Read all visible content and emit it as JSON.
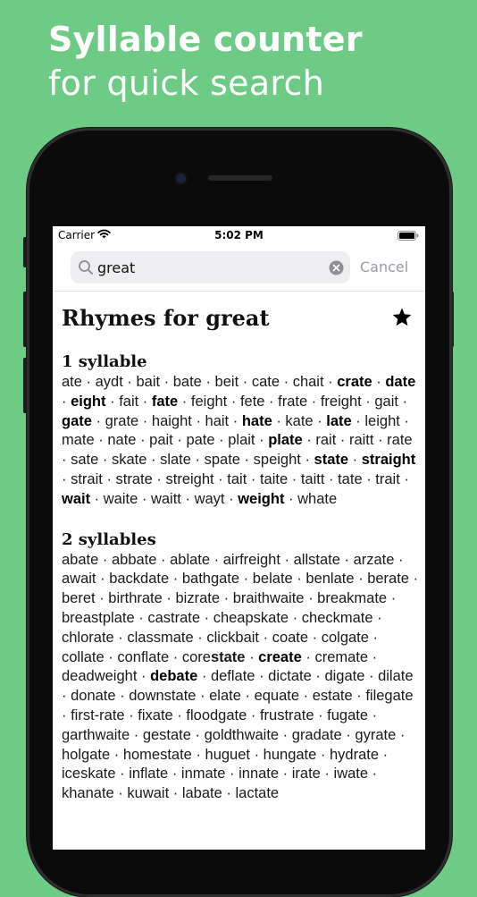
{
  "headline": {
    "bold": "Syllable counter",
    "light": "for quick search"
  },
  "status": {
    "carrier": "Carrier",
    "time": "5:02 PM"
  },
  "search": {
    "value": "great",
    "cancel_label": "Cancel"
  },
  "title": "Rhymes for great",
  "separator": " · ",
  "sections": [
    {
      "heading": "1 syllable",
      "words": [
        {
          "t": "ate"
        },
        {
          "t": "aydt"
        },
        {
          "t": "bait"
        },
        {
          "t": "bate"
        },
        {
          "t": "beit"
        },
        {
          "t": "cate"
        },
        {
          "t": "chait"
        },
        {
          "t": "crate",
          "b": true
        },
        {
          "t": "date",
          "b": true
        },
        {
          "t": "eight",
          "b": true
        },
        {
          "t": "fait"
        },
        {
          "t": "fate",
          "b": true
        },
        {
          "t": "feight"
        },
        {
          "t": "fete"
        },
        {
          "t": "frate"
        },
        {
          "t": "freight"
        },
        {
          "t": "gait"
        },
        {
          "t": "gate",
          "b": true
        },
        {
          "t": "grate"
        },
        {
          "t": "haight"
        },
        {
          "t": "hait"
        },
        {
          "t": "hate",
          "b": true
        },
        {
          "t": "kate"
        },
        {
          "t": "late",
          "b": true
        },
        {
          "t": "leight"
        },
        {
          "t": "mate"
        },
        {
          "t": "nate"
        },
        {
          "t": "pait"
        },
        {
          "t": "pate"
        },
        {
          "t": "plait"
        },
        {
          "t": "plate",
          "b": true
        },
        {
          "t": "rait"
        },
        {
          "t": "raitt"
        },
        {
          "t": "rate"
        },
        {
          "t": "sate"
        },
        {
          "t": "skate"
        },
        {
          "t": "slate"
        },
        {
          "t": "spate"
        },
        {
          "t": "speight"
        },
        {
          "t": "state",
          "b": true
        },
        {
          "t": "straight",
          "b": true
        },
        {
          "t": "strait"
        },
        {
          "t": "strate"
        },
        {
          "t": "streight"
        },
        {
          "t": "tait"
        },
        {
          "t": "taite"
        },
        {
          "t": "taitt"
        },
        {
          "t": "tate"
        },
        {
          "t": "trait"
        },
        {
          "t": "wait",
          "b": true
        },
        {
          "t": "waite"
        },
        {
          "t": "waitt"
        },
        {
          "t": "wayt"
        },
        {
          "t": "weight",
          "b": true
        },
        {
          "t": "whate"
        }
      ]
    },
    {
      "heading": "2 syllables",
      "words": [
        {
          "t": "abate"
        },
        {
          "t": "abbate"
        },
        {
          "t": "ablate"
        },
        {
          "t": "airfreight"
        },
        {
          "t": "allstate"
        },
        {
          "t": "arzate"
        },
        {
          "t": "await"
        },
        {
          "t": "backdate"
        },
        {
          "t": "bathgate"
        },
        {
          "t": "belate"
        },
        {
          "t": "benlate"
        },
        {
          "t": "berate"
        },
        {
          "t": "beret"
        },
        {
          "t": "birthrate"
        },
        {
          "t": "bizrate"
        },
        {
          "t": "braithwaite"
        },
        {
          "t": "breakmate"
        },
        {
          "t": "breastplate"
        },
        {
          "t": "castrate"
        },
        {
          "t": "cheapskate"
        },
        {
          "t": "checkmate"
        },
        {
          "t": "chlorate"
        },
        {
          "t": "classmate"
        },
        {
          "t": "clickbait"
        },
        {
          "t": "coate"
        },
        {
          "t": "colgate"
        },
        {
          "t": "collate"
        },
        {
          "t": "conflate"
        },
        {
          "t": "corestate",
          "p": "core",
          "pb": "state"
        },
        {
          "t": "create",
          "b": true
        },
        {
          "t": "cremate"
        },
        {
          "t": "deadweight"
        },
        {
          "t": "debate",
          "b": true
        },
        {
          "t": "deflate"
        },
        {
          "t": "dictate"
        },
        {
          "t": "digate"
        },
        {
          "t": "dilate"
        },
        {
          "t": "donate"
        },
        {
          "t": "downstate"
        },
        {
          "t": "elate"
        },
        {
          "t": "equate"
        },
        {
          "t": "estate"
        },
        {
          "t": "filegate"
        },
        {
          "t": "first-rate"
        },
        {
          "t": "fixate"
        },
        {
          "t": "floodgate"
        },
        {
          "t": "frustrate"
        },
        {
          "t": "fugate"
        },
        {
          "t": "garthwaite"
        },
        {
          "t": "gestate"
        },
        {
          "t": "goldthwaite"
        },
        {
          "t": "gradate"
        },
        {
          "t": "gyrate"
        },
        {
          "t": "holgate"
        },
        {
          "t": "homestate"
        },
        {
          "t": "huguet"
        },
        {
          "t": "hungate"
        },
        {
          "t": "hydrate"
        },
        {
          "t": "iceskate"
        },
        {
          "t": "inflate"
        },
        {
          "t": "inmate"
        },
        {
          "t": "innate"
        },
        {
          "t": "irate"
        },
        {
          "t": "iwate"
        },
        {
          "t": "khanate"
        },
        {
          "t": "kuwait"
        },
        {
          "t": "labate"
        },
        {
          "t": "lactate"
        }
      ]
    }
  ]
}
